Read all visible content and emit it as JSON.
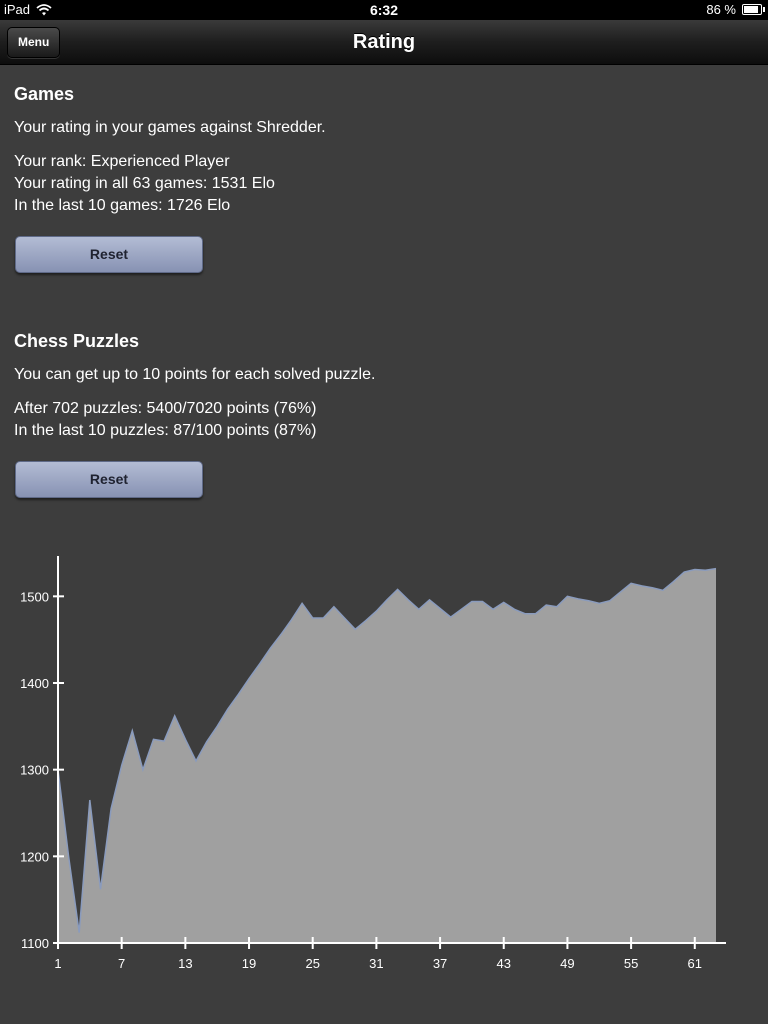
{
  "status_bar": {
    "device": "iPad",
    "time": "6:32",
    "battery": "86 %",
    "battery_level": 0.86
  },
  "nav": {
    "title": "Rating",
    "menu_label": "Menu"
  },
  "games": {
    "title": "Games",
    "description": "Your rating in your games against Shredder.",
    "rank": "Your rank: Experienced Player",
    "rating_all": "Your rating in all 63 games: 1531 Elo",
    "rating_last": "In the last 10 games: 1726 Elo",
    "reset_label": "Reset"
  },
  "puzzles": {
    "title": "Chess Puzzles",
    "description": "You can get up to 10 points for each solved puzzle.",
    "after": "After 702 puzzles: 5400/7020 points (76%)",
    "last": "In the last 10 puzzles: 87/100 points (87%)",
    "reset_label": "Reset"
  },
  "colors": {
    "background": "#3d3d3d",
    "area_fill": "#a0a0a0",
    "area_stroke": "#8a9bbd",
    "axis": "#ffffff",
    "button": "#9aa4c2"
  },
  "chart_data": {
    "type": "area",
    "x": [
      1,
      2,
      3,
      4,
      5,
      6,
      7,
      8,
      9,
      10,
      11,
      12,
      13,
      14,
      15,
      16,
      17,
      18,
      19,
      20,
      21,
      22,
      23,
      24,
      25,
      26,
      27,
      28,
      29,
      30,
      31,
      32,
      33,
      34,
      35,
      36,
      37,
      38,
      39,
      40,
      41,
      42,
      43,
      44,
      45,
      46,
      47,
      48,
      49,
      50,
      51,
      52,
      53,
      54,
      55,
      56,
      57,
      58,
      59,
      60,
      61,
      62,
      63
    ],
    "values": [
      1300,
      1200,
      1112,
      1265,
      1162,
      1255,
      1305,
      1345,
      1300,
      1335,
      1333,
      1362,
      1335,
      1310,
      1332,
      1350,
      1370,
      1387,
      1405,
      1422,
      1440,
      1456,
      1473,
      1492,
      1475,
      1475,
      1488,
      1475,
      1462,
      1472,
      1483,
      1496,
      1508,
      1496,
      1485,
      1496,
      1486,
      1476,
      1485,
      1494,
      1494,
      1485,
      1493,
      1485,
      1480,
      1480,
      1490,
      1488,
      1500,
      1497,
      1495,
      1492,
      1495,
      1505,
      1515,
      1512,
      1510,
      1507,
      1517,
      1528,
      1531,
      1530,
      1532
    ],
    "x_ticks": [
      1,
      7,
      13,
      19,
      25,
      31,
      37,
      43,
      49,
      55,
      61
    ],
    "y_ticks": [
      1100,
      1200,
      1300,
      1400,
      1500
    ],
    "xlim": [
      1,
      63
    ],
    "ylim": [
      1100,
      1550
    ],
    "title": "",
    "xlabel": "",
    "ylabel": ""
  }
}
